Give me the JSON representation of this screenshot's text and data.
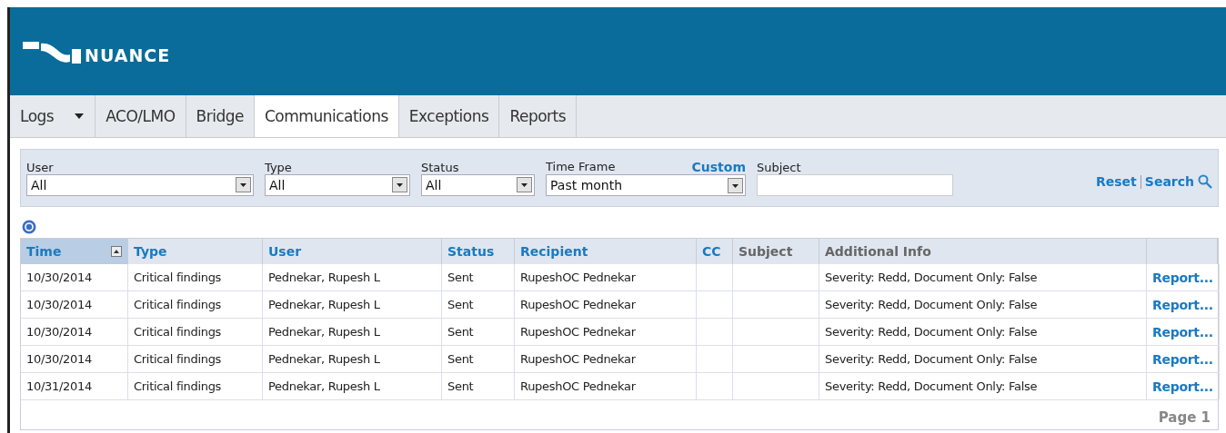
{
  "header": {
    "logo_text": "NUANCE"
  },
  "tabs": [
    {
      "label": "Logs",
      "selected": false,
      "dropdown": true
    },
    {
      "label": "ACO/LMO",
      "selected": false,
      "dropdown": false
    },
    {
      "label": "Bridge",
      "selected": false,
      "dropdown": false
    },
    {
      "label": "Communications",
      "selected": true,
      "dropdown": false
    },
    {
      "label": "Exceptions",
      "selected": false,
      "dropdown": false
    },
    {
      "label": "Reports",
      "selected": false,
      "dropdown": false
    }
  ],
  "filters": [
    {
      "label": "User",
      "kind": "select",
      "value": "All"
    },
    {
      "label": "Type",
      "kind": "select",
      "value": "All"
    },
    {
      "label": "Status",
      "kind": "select",
      "value": "All"
    },
    {
      "label": "Time Frame",
      "kind": "select",
      "value": "Past month",
      "link": "Custom"
    },
    {
      "label": "Subject",
      "kind": "text"
    }
  ],
  "actions": [
    "Reset",
    "Search"
  ],
  "table": {
    "columns": [
      {
        "label": "Time",
        "kind": "link",
        "sorted": true
      },
      {
        "label": "Type",
        "kind": "link",
        "sorted": false
      },
      {
        "label": "User",
        "kind": "link",
        "sorted": false
      },
      {
        "label": "Status",
        "kind": "link",
        "sorted": false
      },
      {
        "label": "Recipient",
        "kind": "link",
        "sorted": false
      },
      {
        "label": "CC",
        "kind": "link",
        "sorted": false
      },
      {
        "label": "Subject",
        "kind": "plain",
        "sorted": false
      },
      {
        "label": "Additional Info",
        "kind": "plain",
        "sorted": false
      },
      {
        "kind": "plain",
        "sorted": false
      }
    ],
    "rows": [
      [
        "10/30/2014",
        "Critical findings",
        "Pednekar, Rupesh L",
        "Sent",
        "RupeshOC Pednekar",
        null,
        null,
        "Severity: Redd, Document Only: False",
        "Report..."
      ],
      [
        "10/30/2014",
        "Critical findings",
        "Pednekar, Rupesh L",
        "Sent",
        "RupeshOC Pednekar",
        null,
        null,
        "Severity: Redd, Document Only: False",
        "Report..."
      ],
      [
        "10/30/2014",
        "Critical findings",
        "Pednekar, Rupesh L",
        "Sent",
        "RupeshOC Pednekar",
        null,
        null,
        "Severity: Redd, Document Only: False",
        "Report..."
      ],
      [
        "10/30/2014",
        "Critical findings",
        "Pednekar, Rupesh L",
        "Sent",
        "RupeshOC Pednekar",
        null,
        null,
        "Severity: Redd, Document Only: False",
        "Report..."
      ],
      [
        "10/31/2014",
        "Critical findings",
        "Pednekar, Rupesh L",
        "Sent",
        "RupeshOC Pednekar",
        null,
        null,
        "Severity: Redd, Document Only: False",
        "Report..."
      ]
    ],
    "pager": "Page 1"
  }
}
